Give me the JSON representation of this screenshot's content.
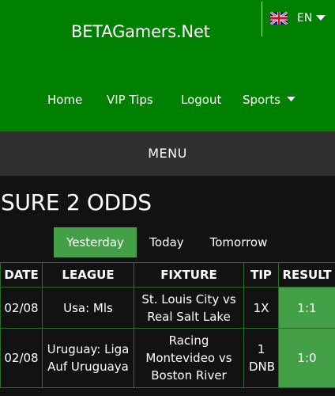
{
  "header": {
    "site_title": "BETAGamers.Net",
    "language": "EN"
  },
  "nav": {
    "items": [
      "Home",
      "VIP Tips",
      "Logout",
      "Sports"
    ]
  },
  "menu_label": "MENU",
  "page_title": "SURE 2 ODDS",
  "tabs": [
    {
      "label": "Yesterday",
      "active": true
    },
    {
      "label": "Today",
      "active": false
    },
    {
      "label": "Tomorrow",
      "active": false
    }
  ],
  "table": {
    "headers": [
      "DATE",
      "LEAGUE",
      "FIXTURE",
      "TIP",
      "RESULT"
    ],
    "rows": [
      {
        "date": "02/08",
        "league": "Usa: Mls",
        "fixture": "St. Louis City vs Real Salt Lake",
        "tip": "1X",
        "result": "1:1"
      },
      {
        "date": "02/08",
        "league": "Uruguay: Liga Auf Uruguaya",
        "fixture": "Racing Montevideo vs Boston River",
        "tip": "1 DNB",
        "result": "1:0"
      }
    ]
  },
  "colors": {
    "header_green": "#008000",
    "accent_green": "#43a047",
    "menu_bar": "#303030",
    "background": "#121212",
    "table_border": "#2b6b2b"
  },
  "icons": [
    "uk-flag-icon",
    "caret-down-icon"
  ]
}
